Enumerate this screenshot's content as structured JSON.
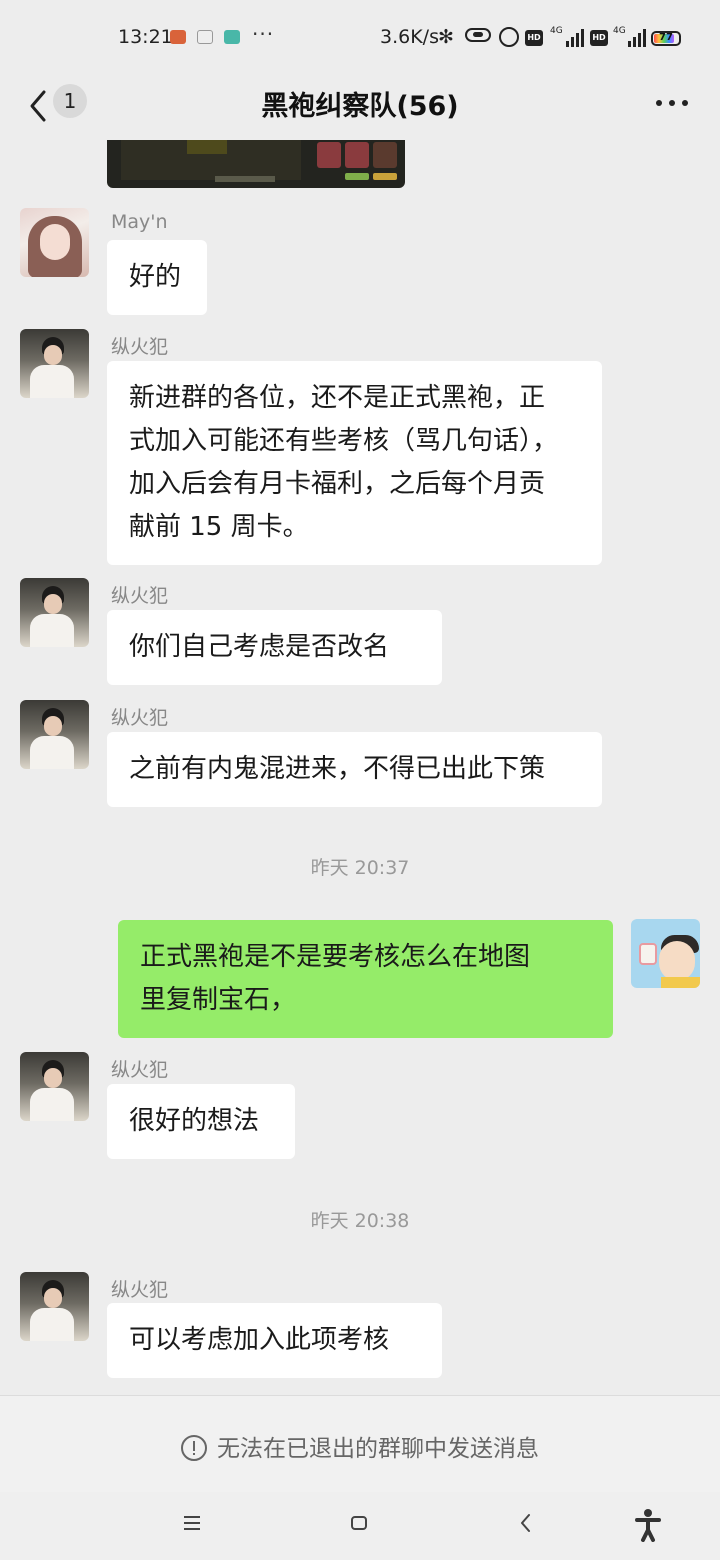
{
  "status_bar": {
    "time": "13:21",
    "more": "···",
    "net_speed": "3.6K/s",
    "bluetooth_glyph": "✻",
    "hd1": "HD",
    "net1": "4G",
    "hd2": "HD",
    "net2": "4G",
    "battery": "77",
    "icons": [
      "app-notification-icon",
      "app-notification-icon",
      "app-notification-icon",
      "bluetooth-icon",
      "vibrate-icon",
      "alarm-icon",
      "signal-icon",
      "battery-icon"
    ]
  },
  "header": {
    "unread_count": "1",
    "title": "黑袍纠察队(56)"
  },
  "messages": [
    {
      "sender": "May'n",
      "text": "好的"
    },
    {
      "sender": "纵火犯",
      "lines": [
        "新进群的各位，还不是正式黑袍，正",
        "式加入可能还有些考核（骂几句话），",
        "加入后会有月卡福利，之后每个月贡",
        "献前 15 周卡。"
      ]
    },
    {
      "sender": "纵火犯",
      "text": "你们自己考虑是否改名"
    },
    {
      "sender": "纵火犯",
      "text": "之前有内鬼混进来，不得已出此下策"
    },
    {
      "timestamp": "昨天 20:37"
    },
    {
      "sender": "me",
      "lines": [
        "正式黑袍是不是要考核怎么在地图",
        "里复制宝石，"
      ]
    },
    {
      "sender": "纵火犯",
      "text": "很好的想法"
    },
    {
      "timestamp": "昨天 20:38"
    },
    {
      "sender": "纵火犯",
      "text": "可以考虑加入此项考核"
    }
  ],
  "footer": {
    "notice": "无法在已退出的群聊中发送消息"
  },
  "colors": {
    "background": "#ededed",
    "incoming_bubble": "#ffffff",
    "outgoing_bubble": "#95ec69"
  }
}
